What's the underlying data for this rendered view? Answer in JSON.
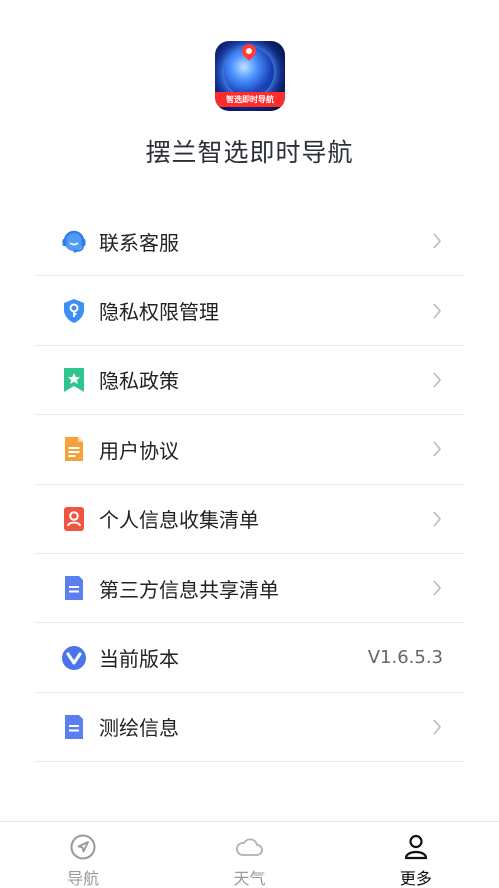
{
  "app": {
    "name": "摆兰智选即时导航",
    "logo_text": "智选即时导航"
  },
  "menu": [
    {
      "label": "联系客服",
      "icon": "customer-service-icon",
      "color": "#3a8ef6",
      "has_chevron": true
    },
    {
      "label": "隐私权限管理",
      "icon": "shield-key-icon",
      "color": "#3a8ef6",
      "has_chevron": true
    },
    {
      "label": "隐私政策",
      "icon": "bookmark-star-icon",
      "color": "#2bc48a",
      "has_chevron": true
    },
    {
      "label": "用户协议",
      "icon": "document-icon",
      "color": "#f5a133",
      "has_chevron": true
    },
    {
      "label": "个人信息收集清单",
      "icon": "user-card-icon",
      "color": "#f2553f",
      "has_chevron": true
    },
    {
      "label": "第三方信息共享清单",
      "icon": "share-document-icon",
      "color": "#5a7ef0",
      "has_chevron": true
    },
    {
      "label": "当前版本",
      "icon": "version-icon",
      "color": "#4a73e8",
      "value": "V1.6.5.3"
    },
    {
      "label": "测绘信息",
      "icon": "survey-document-icon",
      "color": "#5a7ef0",
      "has_chevron": true
    }
  ],
  "tabbar": [
    {
      "label": "导航",
      "icon": "navigation-icon",
      "active": false
    },
    {
      "label": "天气",
      "icon": "cloud-icon",
      "active": false
    },
    {
      "label": "更多",
      "icon": "person-icon",
      "active": true
    }
  ]
}
